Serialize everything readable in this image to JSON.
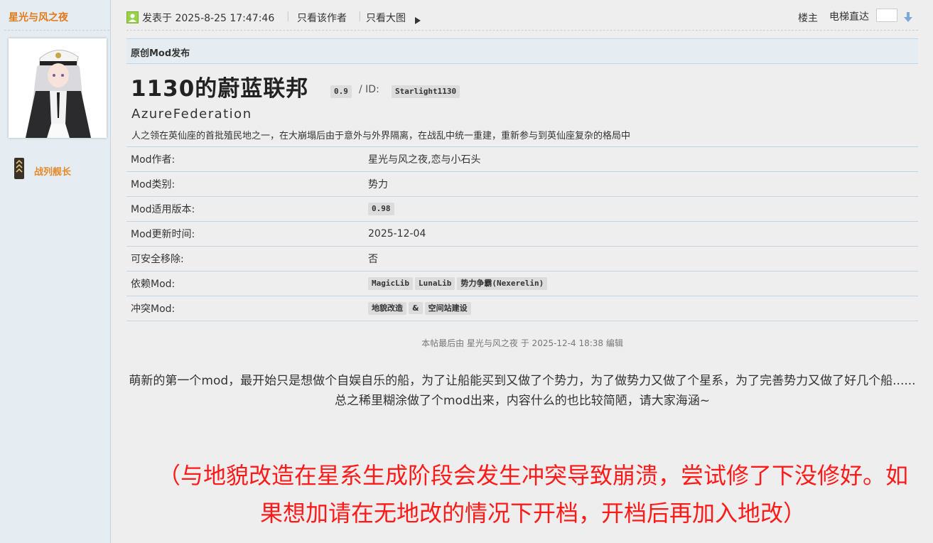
{
  "author": {
    "name": "星光与风之夜",
    "rank": "战列舰长"
  },
  "post_header": {
    "posted_at": "发表于 2025-8-25 17:47:46",
    "only_author": "只看该作者",
    "only_big_image": "只看大图",
    "floor": "楼主",
    "elevator": "电梯直达",
    "elevator_value": ""
  },
  "mod": {
    "section_title": "原创Mod发布",
    "title": "1130的蔚蓝联邦",
    "version": "0.9",
    "id_label": "/ ID:",
    "id": "Starlight1130",
    "subtitle": "AzureFederation",
    "description": "人之领在英仙座的首批殖民地之一，在大崩塌后由于意外与外界隔离，在战乱中统一重建，重新参与到英仙座复杂的格局中",
    "rows": [
      {
        "key": "Mod作者:",
        "value": "星光与风之夜,恋与小石头"
      },
      {
        "key": "Mod类别:",
        "value": "势力"
      },
      {
        "key": "Mod适用版本:",
        "tag": "0.98"
      },
      {
        "key": "Mod更新时间:",
        "value": "2025-12-04"
      },
      {
        "key": "可安全移除:",
        "value": "否"
      },
      {
        "key": "依赖Mod:",
        "tags": [
          "MagicLib",
          "LunaLib",
          "势力争霸(Nexerelin)"
        ]
      },
      {
        "key": "冲突Mod:",
        "tags": [
          "地貌改造",
          "&",
          "空间站建设"
        ]
      }
    ]
  },
  "edit_note": "本帖最后由 星光与风之夜 于 2025-12-4 18:38 编辑",
  "body_text": "萌新的第一个mod，最开始只是想做个自娱自乐的船，为了让船能买到又做了个势力，为了做势力又做了个星系，为了完善势力又做了好几个船......总之稀里糊涂做了个mod出来，内容什么的也比较简陋，请大家海涵~",
  "warning_text": "（与地貌改造在星系生成阶段会发生冲突导致崩溃，尝试修了下没修好。如果想加请在无地改的情况下开档，开档后再加入地改）",
  "colors": {
    "author_orange": "#e17a1d",
    "warning_red": "#ff1a1a",
    "sidebar_bg": "#e5edf2"
  }
}
